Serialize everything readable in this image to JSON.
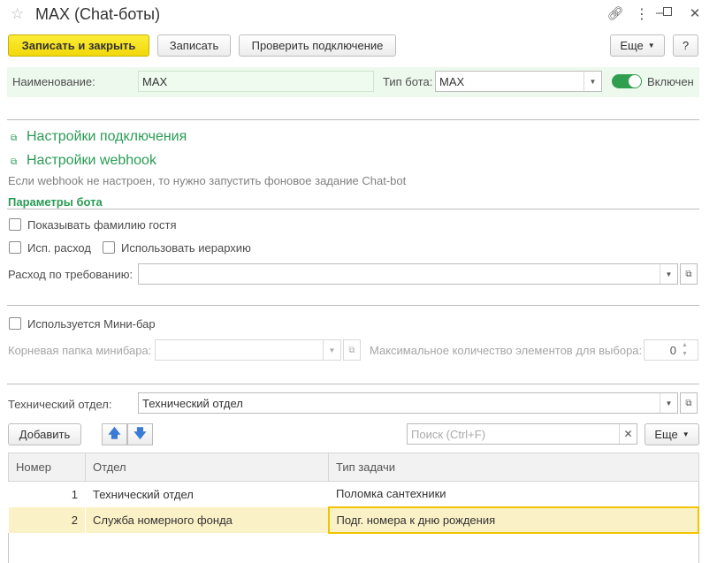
{
  "window": {
    "title": "MAX (Chat-боты)",
    "icons": [
      "star-icon",
      "link-icon",
      "more-icon",
      "minimize-icon",
      "maximize-icon",
      "close-icon"
    ]
  },
  "toolbar": {
    "save_close": "Записать и закрыть",
    "save": "Записать",
    "check_connection": "Проверить подключение",
    "more": "Еще",
    "help": "?"
  },
  "header": {
    "name_label": "Наименование:",
    "name_value": "MAX",
    "bot_type_label": "Тип бота:",
    "bot_type_value": "MAX",
    "enabled_label": "Включен"
  },
  "links": {
    "connection_settings": "Настройки подключения",
    "webhook_settings": "Настройки webhook",
    "webhook_note": "Если webhook не настроен, то нужно запустить фоновое задание Chat-bot"
  },
  "bot_params": {
    "title": "Параметры бота",
    "show_guest_surname": "Показывать фамилию гостя",
    "use_expense": "Исп. расход",
    "use_hierarchy": "Использовать иерархию",
    "expense_on_demand_label": "Расход по требованию:",
    "expense_on_demand_value": ""
  },
  "minibar": {
    "used_label": "Используется Мини-бар",
    "root_folder_label": "Корневая папка минибара:",
    "root_folder_value": "",
    "max_items_label": "Максимальное количество элементов для выбора:",
    "max_items_value": "0"
  },
  "tech": {
    "department_label": "Технический отдел:",
    "department_value": "Технический отдел"
  },
  "table_toolbar": {
    "add": "Добавить",
    "search_placeholder": "Поиск (Ctrl+F)",
    "more": "Еще"
  },
  "table": {
    "columns": [
      "Номер",
      "Отдел",
      "Тип задачи"
    ],
    "rows": [
      {
        "num": "1",
        "dept": "Технический отдел",
        "task": "Поломка сантехники"
      },
      {
        "num": "2",
        "dept": "Служба номерного фонда",
        "task": "Подг. номера к дню рождения"
      }
    ]
  },
  "colors": {
    "accent_green": "#2a9b54",
    "primary_yellow": "#f2d80c",
    "selection": "#fbf1c6"
  }
}
